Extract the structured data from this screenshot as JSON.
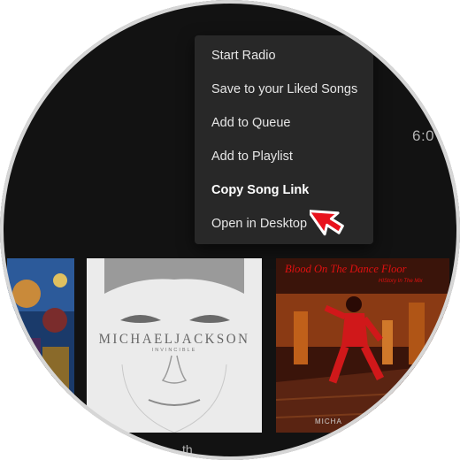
{
  "now_playing": {
    "time": "6:0"
  },
  "context_menu": {
    "items": [
      {
        "label": "Start Radio"
      },
      {
        "label": "Save to your Liked Songs"
      },
      {
        "label": "Add to Queue"
      },
      {
        "label": "Add to Playlist"
      },
      {
        "label": "Copy Song Link"
      },
      {
        "label": "Open in Desktop"
      }
    ],
    "open_in_desktop_icon": "external-link-icon"
  },
  "albums": [
    {
      "cover": "colorful-album-art"
    },
    {
      "cover_title": "MICHAELJACKSON",
      "cover_subtitle": "INVINCIBLE"
    },
    {
      "cover_title": "Blood On The Dance Floor",
      "cover_subtitle": "HIStory In The Mix",
      "cover_footer": "MICHA"
    }
  ],
  "colors": {
    "background": "#121212",
    "menu_background": "#282828",
    "cursor_red": "#e8121c",
    "album_title_red": "#e01010"
  },
  "footer_text": "th"
}
